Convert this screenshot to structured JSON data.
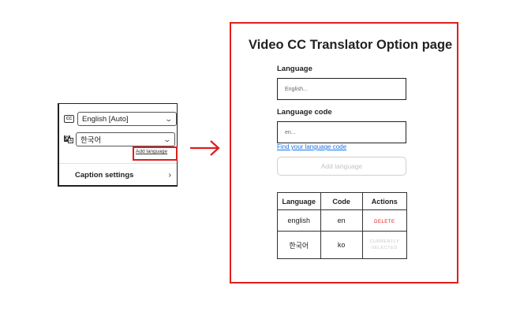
{
  "popup": {
    "caption_select": "English [Auto]",
    "language_select": "한국어",
    "add_language_link": "Add language",
    "caption_settings": "Caption settings",
    "icons": {
      "cc": "CC",
      "translate": "translate-icon"
    }
  },
  "options_page": {
    "title": "Video CC Translator Option page",
    "language_label": "Language",
    "language_placeholder": "English...",
    "code_label": "Language code",
    "code_placeholder": "en...",
    "find_code_link": "Find your language code",
    "add_button": "Add language",
    "table": {
      "headers": [
        "Language",
        "Code",
        "Actions"
      ],
      "rows": [
        {
          "language": "english",
          "code": "en",
          "action": "DELETE"
        },
        {
          "language": "한국어",
          "code": "ko",
          "action": "CURRENTLY SELECTED"
        }
      ]
    }
  },
  "colors": {
    "highlight": "#e11d1d",
    "link": "#1a73e8"
  }
}
